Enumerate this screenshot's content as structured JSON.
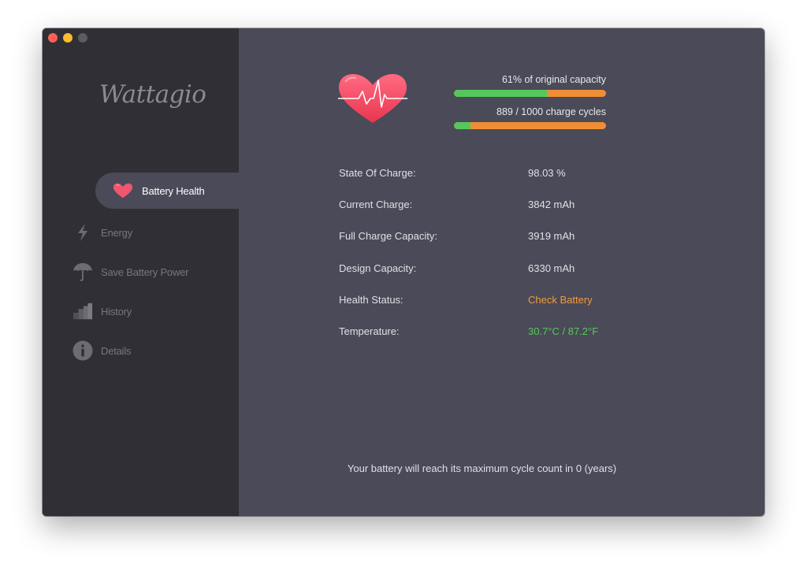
{
  "window": {
    "controls": [
      "close",
      "minimize",
      "zoom"
    ]
  },
  "sidebar": {
    "logo": "Wattagio",
    "items": [
      {
        "label": "Battery Health",
        "icon": "heart-icon",
        "active": true
      },
      {
        "label": "Energy",
        "icon": "lightning-icon",
        "active": false
      },
      {
        "label": "Save Battery Power",
        "icon": "umbrella-icon",
        "active": false
      },
      {
        "label": "History",
        "icon": "history-bars-icon",
        "active": false
      },
      {
        "label": "Details",
        "icon": "info-icon",
        "active": false
      }
    ]
  },
  "main": {
    "capacity": {
      "caption": "61% of original capacity",
      "fraction": 0.61
    },
    "cycles": {
      "caption": "889 / 1000 charge cycles",
      "fraction": 0.11
    },
    "stats": [
      {
        "label": "State Of Charge:",
        "value": "98.03 %"
      },
      {
        "label": "Current Charge:",
        "value": "3842 mAh"
      },
      {
        "label": "Full Charge Capacity:",
        "value": "3919 mAh"
      },
      {
        "label": "Design Capacity:",
        "value": "6330 mAh"
      },
      {
        "label": "Health Status:",
        "value": "Check Battery",
        "status": "warning"
      },
      {
        "label": "Temperature:",
        "value": "30.7°C / 87.2°F",
        "status": "ok"
      }
    ],
    "footer": "Your battery will reach its maximum cycle count in 0 (years)"
  },
  "colors": {
    "accent_green": "#56c75c",
    "accent_orange": "#f08e35",
    "heart_red": "#ef4566"
  }
}
